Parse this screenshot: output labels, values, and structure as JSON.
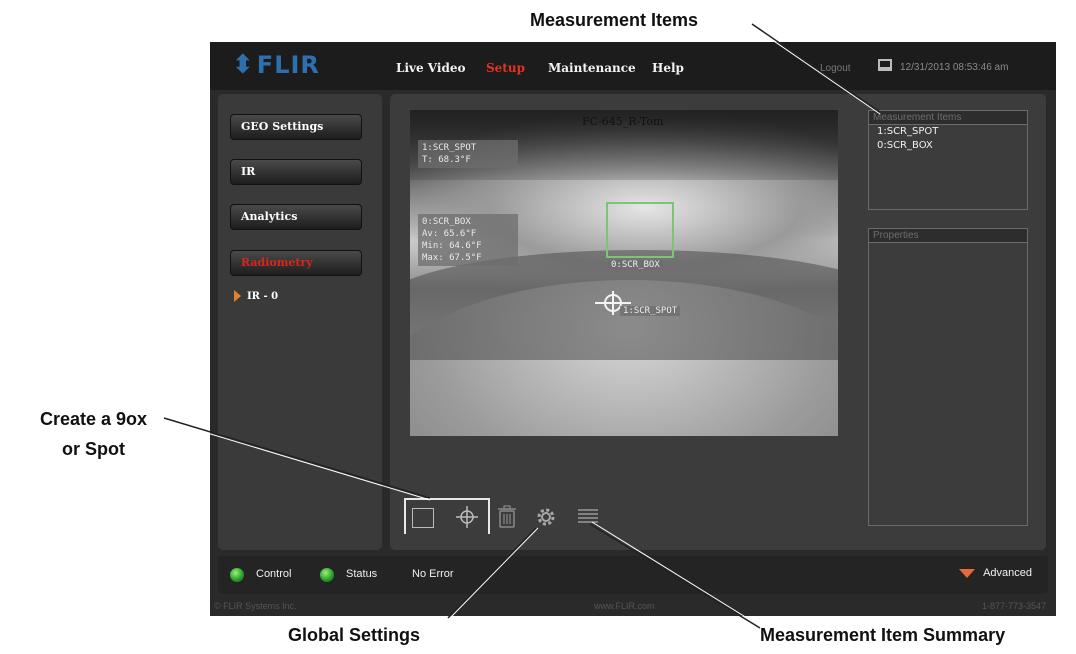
{
  "callouts": {
    "measurement_items": "Measurement Items",
    "create_line1": "Create a 9ox",
    "create_line2": "or Spot",
    "global_settings": "Global Settings",
    "summary": "Measurement Item Summary"
  },
  "header": {
    "logo": "FLIR",
    "nav": {
      "live_video": "Live Video",
      "setup": "Setup",
      "maintenance": "Maintenance",
      "help": "Help",
      "logout": "Logout"
    },
    "datetime": "12/31/2013 08:53:46 am"
  },
  "sidebar": {
    "items": [
      {
        "label": "GEO Settings"
      },
      {
        "label": "IR"
      },
      {
        "label": "Analytics"
      },
      {
        "label": "Radiometry"
      }
    ],
    "sub_item": "IR - 0"
  },
  "video": {
    "camera_name": "FC-645_R-Tom",
    "spot_overlay": [
      "1:SCR_SPOT",
      "T: 68.3°F"
    ],
    "box_overlay": [
      "0:SCR_BOX",
      "Av:  65.6°F",
      "Min: 64.6°F",
      "Max: 67.5°F"
    ],
    "box_tag": "0:SCR_BOX",
    "spot_tag": "1:SCR_SPOT"
  },
  "panels": {
    "items_title": "Measurement Items",
    "items": [
      "1:SCR_SPOT",
      "0:SCR_BOX"
    ],
    "props_title": "Properties"
  },
  "status": {
    "control": "Control",
    "status": "Status",
    "message": "No Error",
    "advanced": "Advanced"
  },
  "footer": {
    "copyright": "© FLIR Systems Inc.",
    "url": "www.FLIR.com",
    "phone": "1-877-773-3547"
  },
  "colors": {
    "active_nav": "#e53224",
    "box_outline": "#7cc576",
    "led_green": "#2aa12a",
    "advanced_icon": "#e86a3b",
    "logo_blue": "#2e6fb0"
  }
}
